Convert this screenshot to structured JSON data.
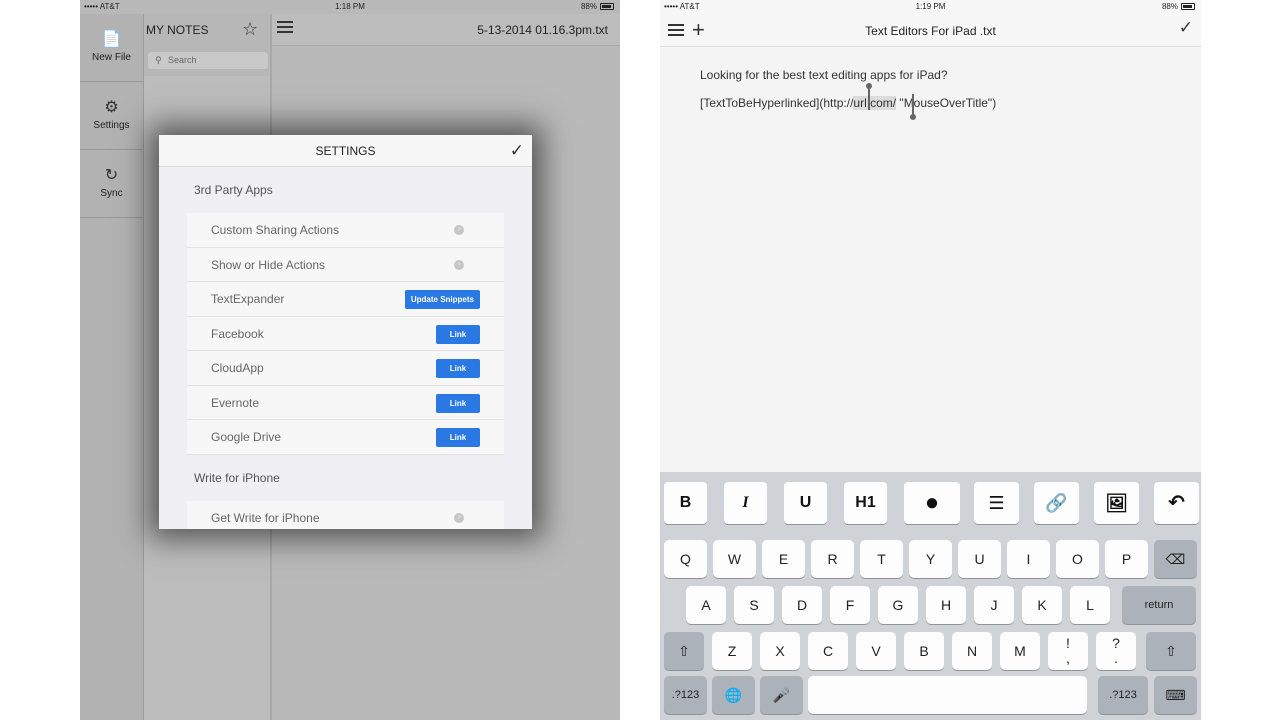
{
  "left": {
    "status": {
      "carrier": "••••• AT&T",
      "time": "1:18 PM",
      "battery": "88%"
    },
    "sidebar": [
      {
        "label": "New File",
        "icon": "📄"
      },
      {
        "label": "Settings",
        "icon": "⚙"
      },
      {
        "label": "Sync",
        "icon": "↻"
      }
    ],
    "list_title": "MY NOTES",
    "search_placeholder": "Search",
    "filename": "5-13-2014 01.16.3pm.txt",
    "settings": {
      "title": "SETTINGS",
      "section1": "3rd Party Apps",
      "rows": [
        {
          "label": "Custom Sharing Actions",
          "kind": "arrow",
          "button": ""
        },
        {
          "label": "Show or Hide Actions",
          "kind": "arrow",
          "button": ""
        },
        {
          "label": "TextExpander",
          "kind": "button",
          "button": "Update Snippets"
        },
        {
          "label": "Facebook",
          "kind": "button",
          "button": "Link"
        },
        {
          "label": "CloudApp",
          "kind": "button",
          "button": "Link"
        },
        {
          "label": "Evernote",
          "kind": "button",
          "button": "Link"
        },
        {
          "label": "Google Drive",
          "kind": "button",
          "button": "Link"
        }
      ],
      "section2": "Write for iPhone",
      "row_last": "Get Write for iPhone"
    }
  },
  "right": {
    "status": {
      "carrier": "••••• AT&T",
      "time": "1:19 PM",
      "battery": "88%"
    },
    "title": "Text Editors For iPad .txt",
    "doc": {
      "line1": "Looking for the best text editing apps for iPad?",
      "line2_pre": "[TextToBeHyperlinked](http://",
      "line2_sel": "url.com/",
      "line2_post": " \"MouseOverTitle\")"
    },
    "format_buttons": [
      "B",
      "I",
      "U",
      "H1",
      "●",
      "☰",
      "🔗",
      "🖼",
      "↶"
    ],
    "keyboard": {
      "row1": [
        "Q",
        "W",
        "E",
        "R",
        "T",
        "Y",
        "U",
        "I",
        "O",
        "P"
      ],
      "row2": [
        "A",
        "S",
        "D",
        "F",
        "G",
        "H",
        "J",
        "K",
        "L"
      ],
      "row3": [
        "Z",
        "X",
        "C",
        "V",
        "B",
        "N",
        "M",
        "!\n,",
        "?\n."
      ],
      "return": "return",
      "numbers": ".?123",
      "backspace": "⌫",
      "shift": "⇧",
      "globe": "🌐",
      "mic": "🎤",
      "hide": "⌨"
    }
  },
  "colors": {
    "link_button": "#2a78e4",
    "keyboard_bg": "#cfd3d8"
  }
}
